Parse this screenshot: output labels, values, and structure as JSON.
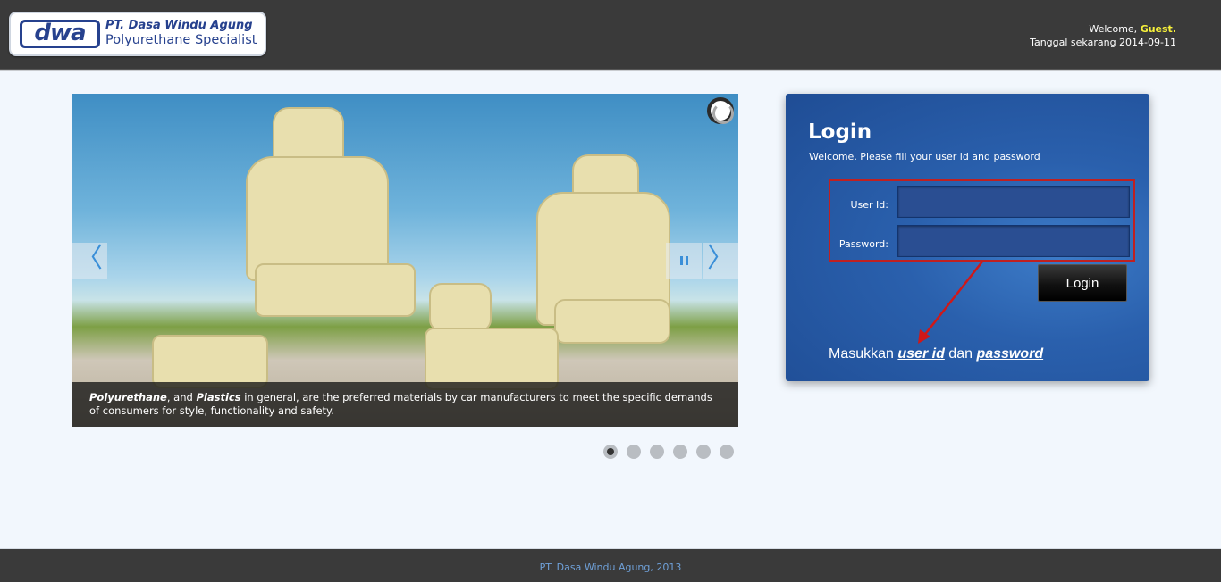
{
  "header": {
    "logo": {
      "mark": "dwa",
      "company": "PT. Dasa Windu Agung",
      "tagline": "Polyurethane Specialist"
    },
    "welcome_prefix": "Welcome,",
    "welcome_user": "Guest.",
    "date_label": "Tanggal sekarang 2014-09-11"
  },
  "slider": {
    "caption_part1": "Polyurethane",
    "caption_part2": ", and ",
    "caption_part3": "Plastics",
    "caption_part4": " in general, are the preferred materials by car manufacturers to meet the specific demands of consumers for style, functionality and safety.",
    "prev_icon": "chevron-left-icon",
    "next_icon": "chevron-right-icon",
    "pause_icon": "pause-icon",
    "dot_count": 6,
    "active_dot": 1
  },
  "login": {
    "title": "Login",
    "subtitle": "Welcome. Please fill your user id and password",
    "user_label": "User Id:",
    "user_value": "",
    "password_label": "Password:",
    "password_value": "",
    "button_label": "Login",
    "annotation_prefix": "Masukkan ",
    "annotation_userid": "user id",
    "annotation_middle": " dan ",
    "annotation_password": "password"
  },
  "footer": {
    "text": "PT. Dasa Windu Agung, 2013"
  },
  "colors": {
    "header_bg": "#3a3a3a",
    "panel_blue": "#2a60ad",
    "guest_yellow": "#f7f13a",
    "highlight_red": "#c02020",
    "footer_text": "#6fa0d8"
  }
}
